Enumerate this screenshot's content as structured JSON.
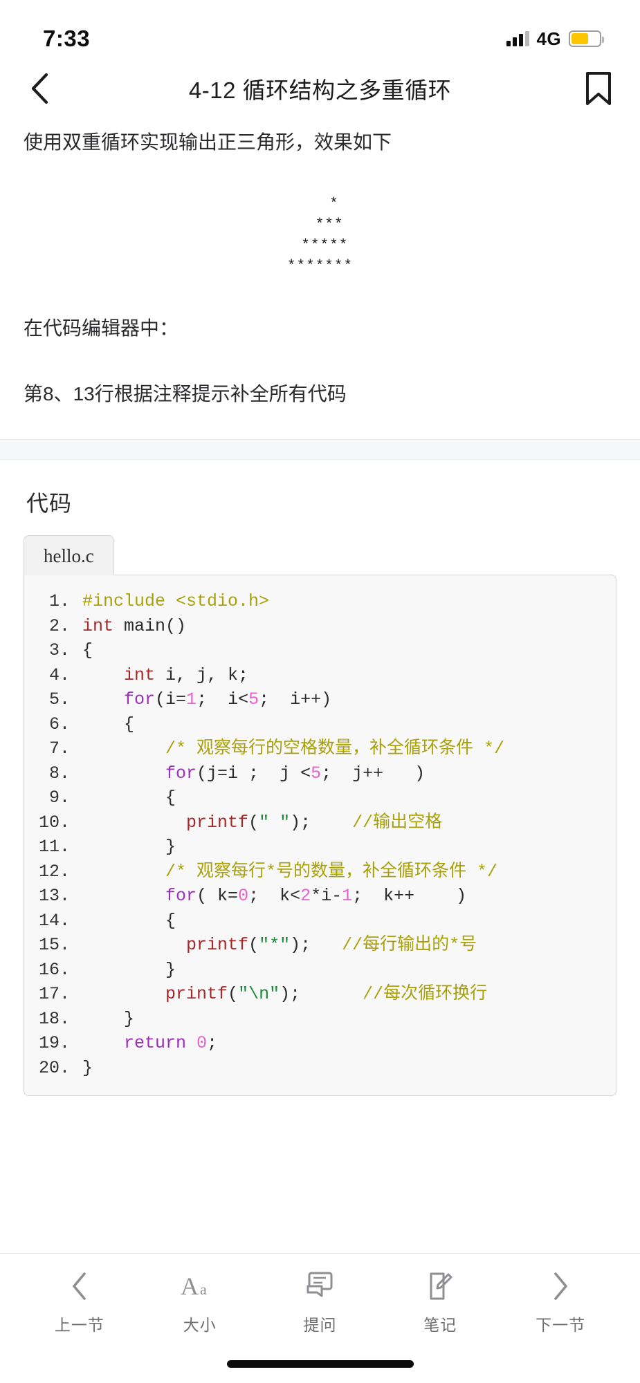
{
  "status_bar": {
    "time": "7:33",
    "network": "4G",
    "signal_icon": "signal-bars-icon",
    "battery_icon": "battery-low-power-icon"
  },
  "nav": {
    "back_icon": "chevron-left-icon",
    "title": "4-12 循环结构之多重循环",
    "bookmark_icon": "bookmark-icon"
  },
  "article": {
    "intro": "使用双重循环实现输出正三角形，效果如下",
    "ascii_art": "   *\n  ***\n *****\n*******",
    "line_editor": "在代码编辑器中：",
    "line_task": "第8、13行根据注释提示补全所有代码"
  },
  "code": {
    "heading": "代码",
    "tab_label": "hello.c",
    "lines": [
      {
        "no": "1.",
        "tokens": [
          {
            "t": "#include <stdio.h>",
            "c": "pre"
          }
        ]
      },
      {
        "no": "2.",
        "tokens": [
          {
            "t": "int",
            "c": "type"
          },
          {
            "t": " main()",
            "c": "plain"
          }
        ]
      },
      {
        "no": "3.",
        "tokens": [
          {
            "t": "{",
            "c": "plain"
          }
        ]
      },
      {
        "no": "4.",
        "tokens": [
          {
            "t": "    ",
            "c": "plain"
          },
          {
            "t": "int",
            "c": "type"
          },
          {
            "t": " i, j, k;",
            "c": "plain"
          }
        ]
      },
      {
        "no": "5.",
        "tokens": [
          {
            "t": "    ",
            "c": "plain"
          },
          {
            "t": "for",
            "c": "kw"
          },
          {
            "t": "(i=",
            "c": "plain"
          },
          {
            "t": "1",
            "c": "num"
          },
          {
            "t": ";  i<",
            "c": "plain"
          },
          {
            "t": "5",
            "c": "num"
          },
          {
            "t": ";  i++)",
            "c": "plain"
          }
        ]
      },
      {
        "no": "6.",
        "tokens": [
          {
            "t": "    {",
            "c": "plain"
          }
        ]
      },
      {
        "no": "7.",
        "tokens": [
          {
            "t": "        ",
            "c": "plain"
          },
          {
            "t": "/* 观察每行的空格数量，补全循环条件 */",
            "c": "cmt"
          }
        ]
      },
      {
        "no": "8.",
        "tokens": [
          {
            "t": "        ",
            "c": "plain"
          },
          {
            "t": "for",
            "c": "kw"
          },
          {
            "t": "(j=i ;  j <",
            "c": "plain"
          },
          {
            "t": "5",
            "c": "num"
          },
          {
            "t": ";  j++   )",
            "c": "plain"
          }
        ]
      },
      {
        "no": "9.",
        "tokens": [
          {
            "t": "        {",
            "c": "plain"
          }
        ]
      },
      {
        "no": "10.",
        "tokens": [
          {
            "t": "          ",
            "c": "plain"
          },
          {
            "t": "printf",
            "c": "type"
          },
          {
            "t": "(",
            "c": "plain"
          },
          {
            "t": "\" \"",
            "c": "str"
          },
          {
            "t": ");    ",
            "c": "plain"
          },
          {
            "t": "//输出空格",
            "c": "cmt"
          }
        ]
      },
      {
        "no": "11.",
        "tokens": [
          {
            "t": "        }",
            "c": "plain"
          }
        ]
      },
      {
        "no": "12.",
        "tokens": [
          {
            "t": "        ",
            "c": "plain"
          },
          {
            "t": "/* 观察每行*号的数量，补全循环条件 */",
            "c": "cmt"
          }
        ]
      },
      {
        "no": "13.",
        "tokens": [
          {
            "t": "        ",
            "c": "plain"
          },
          {
            "t": "for",
            "c": "kw"
          },
          {
            "t": "( k=",
            "c": "plain"
          },
          {
            "t": "0",
            "c": "num"
          },
          {
            "t": ";  k<",
            "c": "plain"
          },
          {
            "t": "2",
            "c": "num"
          },
          {
            "t": "*i-",
            "c": "plain"
          },
          {
            "t": "1",
            "c": "num"
          },
          {
            "t": ";  k++    )",
            "c": "plain"
          }
        ]
      },
      {
        "no": "14.",
        "tokens": [
          {
            "t": "        {",
            "c": "plain"
          }
        ]
      },
      {
        "no": "15.",
        "tokens": [
          {
            "t": "          ",
            "c": "plain"
          },
          {
            "t": "printf",
            "c": "type"
          },
          {
            "t": "(",
            "c": "plain"
          },
          {
            "t": "\"*\"",
            "c": "str"
          },
          {
            "t": ");   ",
            "c": "plain"
          },
          {
            "t": "//每行输出的*号",
            "c": "cmt"
          }
        ]
      },
      {
        "no": "16.",
        "tokens": [
          {
            "t": "        }",
            "c": "plain"
          }
        ]
      },
      {
        "no": "17.",
        "tokens": [
          {
            "t": "        ",
            "c": "plain"
          },
          {
            "t": "printf",
            "c": "type"
          },
          {
            "t": "(",
            "c": "plain"
          },
          {
            "t": "\"\\n\"",
            "c": "str"
          },
          {
            "t": ");      ",
            "c": "plain"
          },
          {
            "t": "//每次循环换行",
            "c": "cmt"
          }
        ]
      },
      {
        "no": "18.",
        "tokens": [
          {
            "t": "    }",
            "c": "plain"
          }
        ]
      },
      {
        "no": "19.",
        "tokens": [
          {
            "t": "    ",
            "c": "plain"
          },
          {
            "t": "return",
            "c": "kw"
          },
          {
            "t": " ",
            "c": "plain"
          },
          {
            "t": "0",
            "c": "num"
          },
          {
            "t": ";",
            "c": "plain"
          }
        ]
      },
      {
        "no": "20.",
        "tokens": [
          {
            "t": "}",
            "c": "plain"
          }
        ]
      }
    ]
  },
  "bottom_bar": {
    "items": [
      {
        "label": "上一节",
        "icon": "chevron-left-icon"
      },
      {
        "label": "大小",
        "icon": "font-size-icon"
      },
      {
        "label": "提问",
        "icon": "chat-bubble-icon"
      },
      {
        "label": "笔记",
        "icon": "note-edit-icon"
      },
      {
        "label": "下一节",
        "icon": "chevron-right-icon"
      }
    ]
  },
  "colors": {
    "comment": "#a9a10a",
    "keyword": "#9b30b8",
    "type": "#a42a2a",
    "number": "#e862cf",
    "string": "#1d8a3a",
    "battery": "#fdc500"
  }
}
